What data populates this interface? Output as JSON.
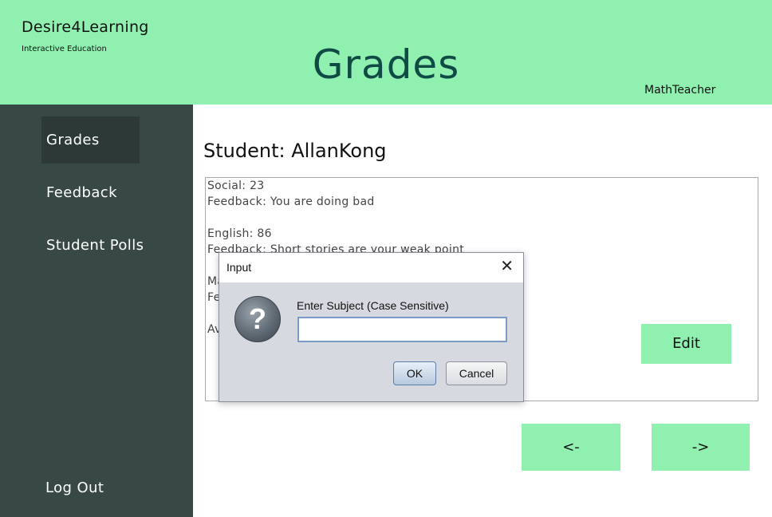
{
  "header": {
    "brand": "Desire4Learning",
    "tagline": "Interactive Education",
    "page_title": "Grades",
    "username": "MathTeacher"
  },
  "sidebar": {
    "items": [
      {
        "label": "Grades",
        "active": true
      },
      {
        "label": "Feedback",
        "active": false
      },
      {
        "label": "Student Polls",
        "active": false
      }
    ],
    "logout_label": "Log Out"
  },
  "main": {
    "student_heading": "Student: AllanKong",
    "grade_lines": [
      "Social: 23",
      "Feedback: You are doing bad",
      "",
      "English: 86",
      "Feedback: Short stories are your weak point",
      "",
      "Ma",
      "Fe",
      "",
      "Av"
    ],
    "edit_label": "Edit",
    "prev_label": "<-",
    "next_label": "->"
  },
  "dialog": {
    "title": "Input",
    "close_glyph": "✕",
    "icon": "question-icon",
    "icon_glyph": "?",
    "message": "Enter Subject (Case Sensitive)",
    "input_value": "",
    "ok_label": "OK",
    "cancel_label": "Cancel"
  },
  "colors": {
    "header_bg": "#8ff0b0",
    "sidebar_bg": "#384845",
    "sidebar_active_bg": "#2c3937",
    "title_color": "#0f4a44",
    "button_green": "#8ff0b0"
  }
}
